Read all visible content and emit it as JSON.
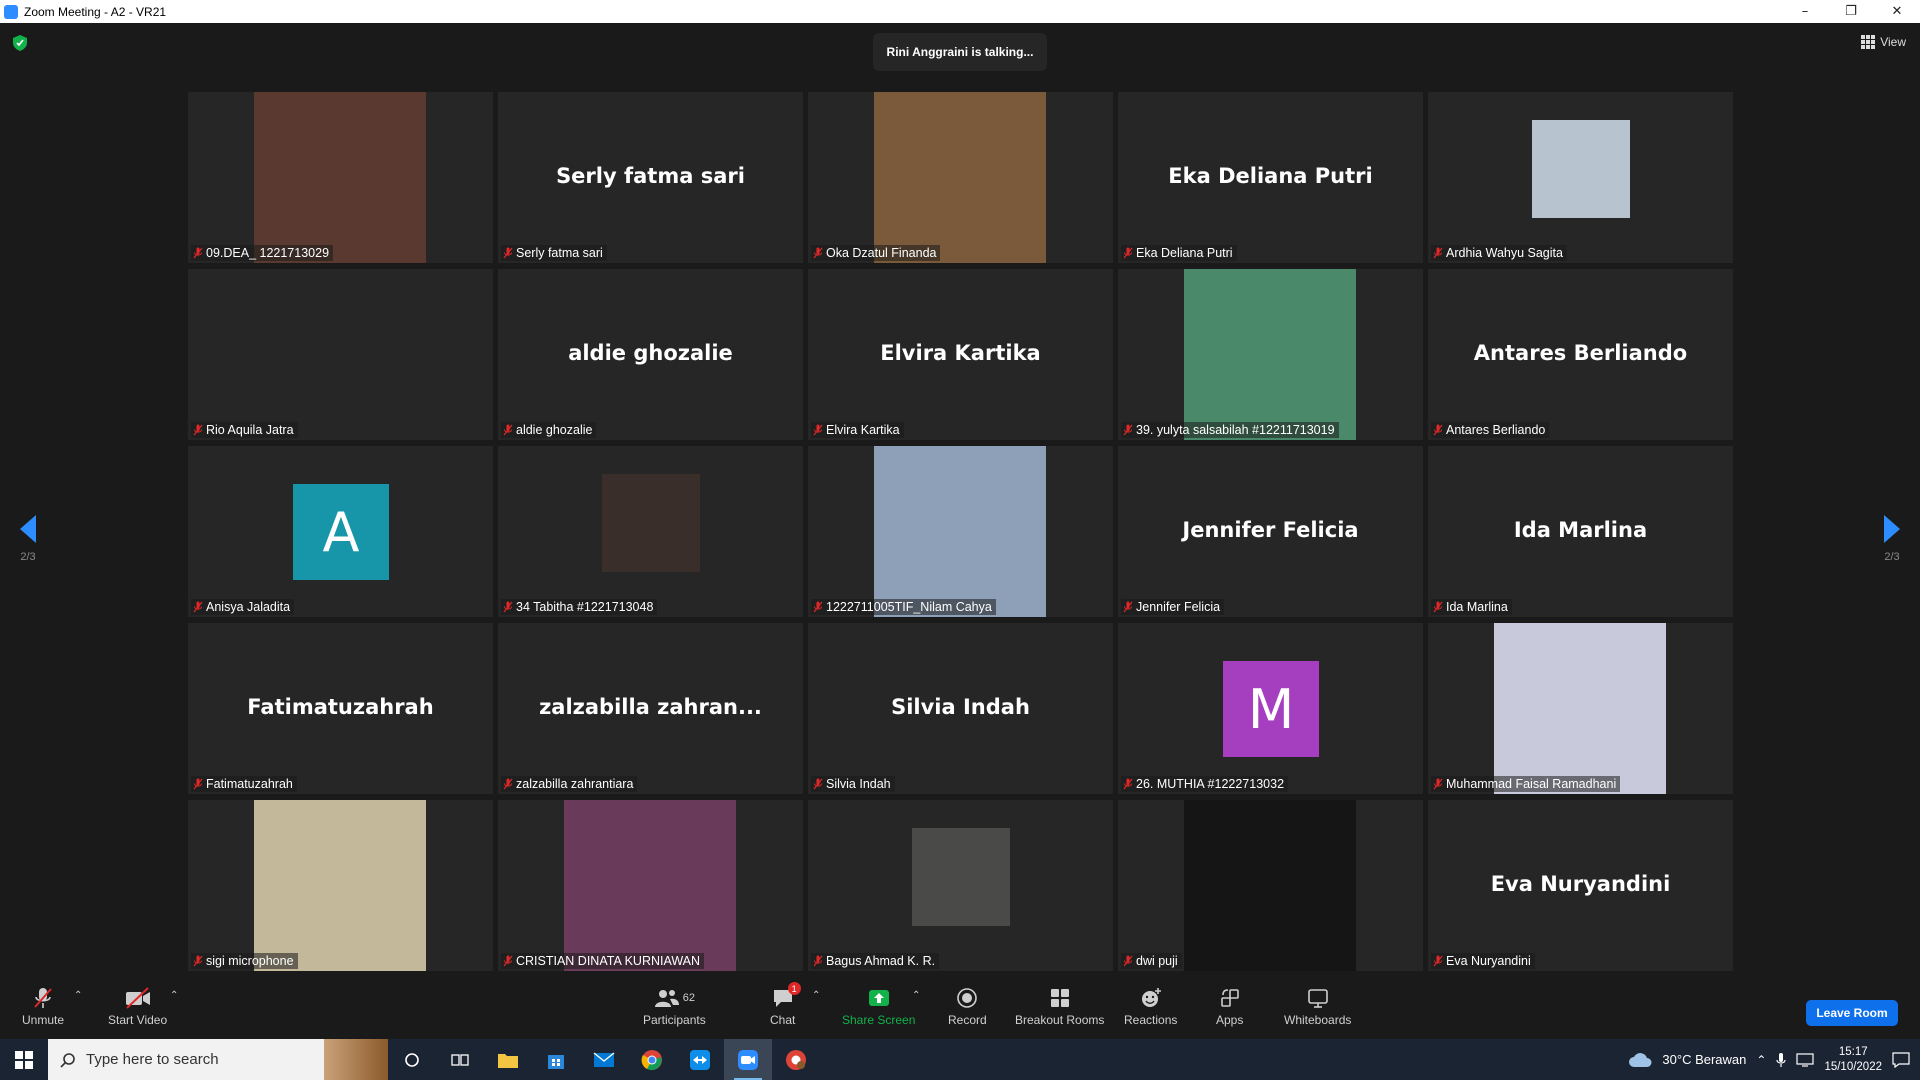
{
  "window": {
    "title": "Zoom Meeting - A2 - VR21",
    "minimize": "–",
    "restore": "❐",
    "close": "✕"
  },
  "meeting": {
    "talking_indicator": "Rini Anggraini is talking...",
    "view_label": "View",
    "page_left": "2/3",
    "page_right": "2/3"
  },
  "tiles": [
    {
      "label": "09.DEA_ 1221713029",
      "big_name": "",
      "kind": "photo",
      "photo_color": "#5a3a30"
    },
    {
      "label": "Serly fatma sari",
      "big_name": "Serly fatma sari",
      "kind": "name"
    },
    {
      "label": "Oka Dzatul Finanda",
      "big_name": "",
      "kind": "photo",
      "photo_color": "#7a5a3a"
    },
    {
      "label": "Eka Deliana Putri",
      "big_name": "Eka Deliana Putri",
      "kind": "name"
    },
    {
      "label": "Ardhia Wahyu Sagita",
      "big_name": "",
      "kind": "photo-small",
      "photo_color": "#b8c3d0"
    },
    {
      "label": "Rio Aquila Jatra",
      "big_name": "",
      "kind": "blank"
    },
    {
      "label": "aldie ghozalie",
      "big_name": "aldie ghozalie",
      "kind": "name"
    },
    {
      "label": "Elvira Kartika",
      "big_name": "Elvira Kartika",
      "kind": "name"
    },
    {
      "label": "39. yulyta salsabilah #12211713019",
      "big_name": "",
      "kind": "photo",
      "photo_color": "#4a8a6a"
    },
    {
      "label": "Antares Berliando",
      "big_name": "Antares Berliando",
      "kind": "name"
    },
    {
      "label": "Anisya Jaladita",
      "big_name": "",
      "kind": "avatar",
      "initial": "A",
      "avatar_color": "#1896a9"
    },
    {
      "label": "34 Tabitha #1221713048",
      "big_name": "",
      "kind": "photo-small",
      "photo_color": "#3a2e2a"
    },
    {
      "label": "1222711005TIF_Nilam Cahya",
      "big_name": "",
      "kind": "photo",
      "photo_color": "#8da0b8"
    },
    {
      "label": "Jennifer Felicia",
      "big_name": "Jennifer Felicia",
      "kind": "name"
    },
    {
      "label": "Ida Marlina",
      "big_name": "Ida Marlina",
      "kind": "name"
    },
    {
      "label": "Fatimatuzahrah",
      "big_name": "Fatimatuzahrah",
      "kind": "name"
    },
    {
      "label": "zalzabilla zahrantiara",
      "big_name": "zalzabilla  zahran...",
      "kind": "name"
    },
    {
      "label": "Silvia Indah",
      "big_name": "Silvia Indah",
      "kind": "name"
    },
    {
      "label": "26. MUTHIA #1222713032",
      "big_name": "",
      "kind": "avatar",
      "initial": "M",
      "avatar_color": "#a63fbf"
    },
    {
      "label": "Muhammad Faisal Ramadhani",
      "big_name": "",
      "kind": "photo",
      "photo_color": "#c9c9dc"
    },
    {
      "label": "sigi microphone",
      "big_name": "",
      "kind": "photo",
      "photo_color": "#c4b89a"
    },
    {
      "label": "CRISTIAN DINATA KURNIAWAN",
      "big_name": "",
      "kind": "photo",
      "photo_color": "#6a3a5a"
    },
    {
      "label": "Bagus Ahmad K. R.",
      "big_name": "",
      "kind": "photo-small",
      "photo_color": "#4a4a48"
    },
    {
      "label": "dwi puji",
      "big_name": "",
      "kind": "photo",
      "photo_color": "#151515"
    },
    {
      "label": "Eva Nuryandini",
      "big_name": "Eva Nuryandini",
      "kind": "name"
    }
  ],
  "toolbar": {
    "unmute": "Unmute",
    "start_video": "Start Video",
    "participants": "Participants",
    "participants_count": "62",
    "chat": "Chat",
    "chat_badge": "1",
    "share_screen": "Share Screen",
    "record": "Record",
    "breakout_rooms": "Breakout Rooms",
    "reactions": "Reactions",
    "apps": "Apps",
    "whiteboards": "Whiteboards",
    "leave": "Leave Room"
  },
  "taskbar": {
    "search_placeholder": "Type here to search",
    "weather": "30°C  Berawan",
    "time": "15:17",
    "date": "15/10/2022"
  },
  "colors": {
    "accent": "#2d8cff",
    "muted_red": "#e02828",
    "share_green": "#12b24b",
    "leave_blue": "#0e71eb"
  }
}
